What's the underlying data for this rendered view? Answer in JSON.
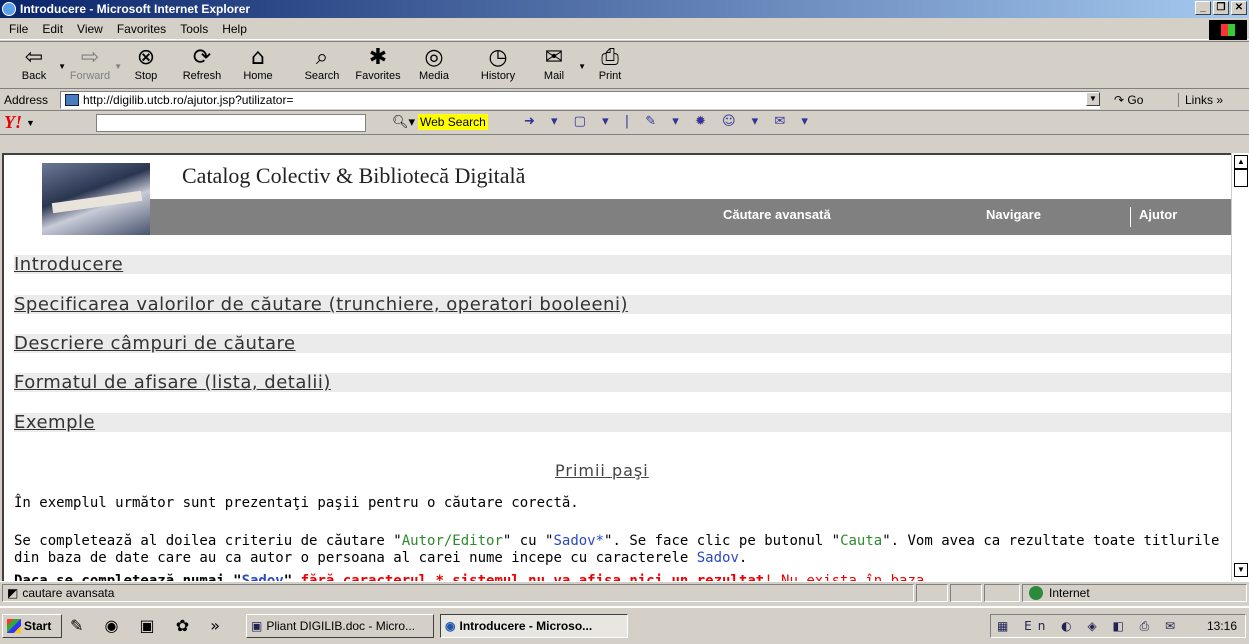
{
  "window": {
    "title": "Introducere - Microsoft Internet Explorer"
  },
  "menu": [
    "File",
    "Edit",
    "View",
    "Favorites",
    "Tools",
    "Help"
  ],
  "toolbar": {
    "buttons": [
      {
        "label": "Back",
        "icon": "back-arrow-icon",
        "glyph": "⇦",
        "enabled": true
      },
      {
        "label": "Forward",
        "icon": "forward-arrow-icon",
        "glyph": "⇨",
        "enabled": false
      },
      {
        "label": "Stop",
        "icon": "stop-icon",
        "glyph": "⊗",
        "enabled": true
      },
      {
        "label": "Refresh",
        "icon": "refresh-icon",
        "glyph": "⟳",
        "enabled": true
      },
      {
        "label": "Home",
        "icon": "home-icon",
        "glyph": "⌂",
        "enabled": true
      },
      {
        "label": "Search",
        "icon": "search-icon",
        "glyph": "⌕",
        "enabled": true
      },
      {
        "label": "Favorites",
        "icon": "favorites-icon",
        "glyph": "✱",
        "enabled": true
      },
      {
        "label": "Media",
        "icon": "media-icon",
        "glyph": "◎",
        "enabled": true
      },
      {
        "label": "History",
        "icon": "history-icon",
        "glyph": "◷",
        "enabled": true
      },
      {
        "label": "Mail",
        "icon": "mail-icon",
        "glyph": "✉",
        "enabled": true
      },
      {
        "label": "Print",
        "icon": "print-icon",
        "glyph": "⎙",
        "enabled": true
      }
    ]
  },
  "address": {
    "label": "Address",
    "url": "http://digilib.utcb.ro/ajutor.jsp?utilizator=",
    "go": "Go",
    "links": "Links"
  },
  "yahoo": {
    "logo": "Y!",
    "web_search": "Web Search",
    "icons": "➜ ▾ ▢ ▾ | ✎ ▾ ✹ ☺ ▾ ✉ ▾"
  },
  "page": {
    "title": "Catalog Colectiv & Bibliotecă Digitală",
    "nav": {
      "advanced": "Căutare avansată",
      "browse": "Navigare",
      "help": "Ajutor"
    },
    "toc": [
      "Introducere",
      "Specificarea valorilor de căutare (trunchiere, operatori booleeni)",
      "Descriere câmpuri de căutare",
      "Formatul de afisare (lista, detalii)",
      "Exemple"
    ],
    "section_title": "Primii paşi",
    "intro": "În exemplul următor sunt prezentaţi paşii pentru o căutare corectă.",
    "p2": {
      "a": "Se completează al doilea criteriu de căutare \"",
      "autor": "Autor/Editor",
      "b": "\" cu \"",
      "sadov": "Sadov*",
      "c": "\". Se face clic pe butonul \"",
      "cauta": "Cauta",
      "d": "\". Vom avea ca rezultate toate titlurile din baza de date care au ca autor o persoana al carei nume incepe cu caracterele ",
      "sadov2": "Sadov",
      "e": "."
    },
    "p3": {
      "a": "Daca se completează numai \"",
      "sadov": "Sadov",
      "b": "\" ",
      "red": "fără caracterul * sistemul nu va afisa nici un rezultat",
      "c": "! Nu exista în baza"
    }
  },
  "status": {
    "message": "cautare avansata",
    "zone": "Internet"
  },
  "taskbar": {
    "start": "Start",
    "quicklaunch": "✎ ◉ ▣ ✿ »",
    "tasks": [
      {
        "label": "Pliant DIGILIB.doc - Micro...",
        "active": false
      },
      {
        "label": "Introducere - Microso...",
        "active": true
      }
    ],
    "tray_icons": "▦ En ◐ ◈ ◧ ⎙ ✉",
    "clock": "13:16"
  }
}
